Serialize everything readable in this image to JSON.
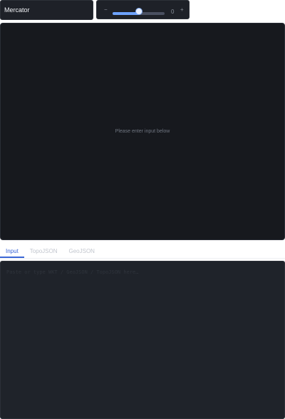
{
  "projection": {
    "selected": "Mercator"
  },
  "slider": {
    "minus_icon": "minus-icon",
    "plus_icon": "plus-icon",
    "value": "0",
    "level": 0.5
  },
  "map": {
    "empty_message": "Please enter input below"
  },
  "tabs": [
    {
      "label": "Input",
      "active": true
    },
    {
      "label": "TopoJSON",
      "active": false
    },
    {
      "label": "GeoJSON",
      "active": false
    }
  ],
  "editor": {
    "placeholder": "Paste or type WKT / GeoJSON / TopoJSON here…"
  },
  "colors": {
    "accent": "#3b66d6",
    "panel": "#1e2128",
    "canvas": "#17191e",
    "slider_fill": "#6ea3ff"
  }
}
